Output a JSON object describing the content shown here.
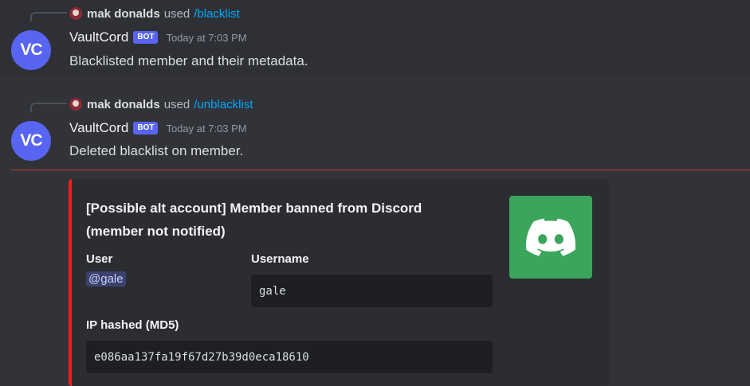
{
  "messages": [
    {
      "reply": {
        "user": "mak donalds",
        "used": "used",
        "command": "/blacklist"
      },
      "author": {
        "avatar_text": "VC",
        "name": "VaultCord",
        "tag": "BOT",
        "timestamp": "Today at 7:03 PM"
      },
      "content": "Blacklisted member and their metadata."
    },
    {
      "reply": {
        "user": "mak donalds",
        "used": "used",
        "command": "/unblacklist"
      },
      "author": {
        "avatar_text": "VC",
        "name": "VaultCord",
        "tag": "BOT",
        "timestamp": "Today at 7:03 PM"
      },
      "content": "Deleted blacklist on member."
    }
  ],
  "embed": {
    "accent_color": "#ee1f1f",
    "title_line1": "[Possible alt account] Member banned from Discord",
    "title_line2": "(member not notified)",
    "fields": {
      "user_label": "User",
      "user_value": "@gale",
      "username_label": "Username",
      "username_value": "gale",
      "ip_label": "IP hashed (MD5)",
      "ip_value": "e086aa137fa19f67d27b39d0eca18610"
    },
    "thumbnail_icon": "discord-logo-icon",
    "thumbnail_color": "#3ba55c"
  },
  "colors": {
    "background": "#313338",
    "brand": "#5865f2",
    "link": "#00a8fc",
    "new_divider": "#c0363c"
  }
}
